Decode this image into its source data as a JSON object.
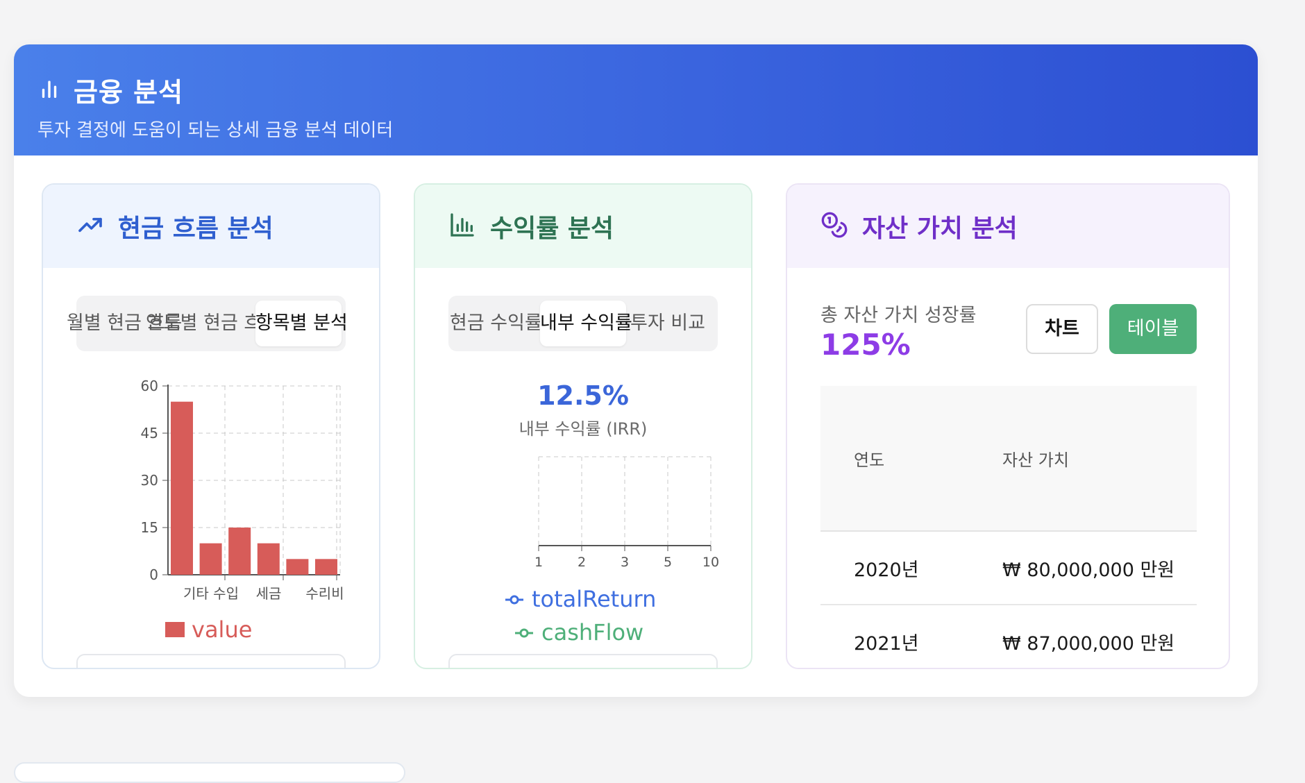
{
  "header": {
    "title": "금융 분석",
    "subtitle": "투자 결정에 도움이 되는 상세 금융 분석 데이터"
  },
  "cashflow": {
    "title": "현금 흐름 분석",
    "tabs": [
      "월별 현금 흐름",
      "연도별 현금 흐름",
      "항목별 분석"
    ],
    "active_tab": "항목별 분석",
    "chart_data": {
      "type": "bar",
      "categories": [
        "",
        "",
        "기타 수입",
        "",
        "세금",
        "",
        "수리비"
      ],
      "series": [
        {
          "name": "value",
          "values": [
            55,
            10,
            15,
            10,
            5,
            5
          ]
        }
      ],
      "ylim": [
        0,
        60
      ],
      "yticks": [
        "0",
        "15",
        "30",
        "45",
        "60"
      ],
      "xtick_labels": [
        "기타 수입",
        "세금",
        "수리비"
      ],
      "grid": true,
      "bar_color": "#d75c59",
      "legend": "bottom"
    }
  },
  "returns": {
    "title": "수익률 분석",
    "tabs": [
      "현금 수익률",
      "내부 수익률",
      "투자 비교"
    ],
    "active_tab": "내부 수익률",
    "irr_value": "12.5%",
    "irr_label": "내부 수익률 (IRR)",
    "chart_data": {
      "type": "line",
      "x": [
        "1",
        "2",
        "3",
        "5",
        "10"
      ],
      "series": [
        {
          "name": "totalReturn",
          "values": [],
          "color": "#3f6fe0"
        },
        {
          "name": "cashFlow",
          "values": [],
          "color": "#4eaf79"
        }
      ],
      "grid": true,
      "legend": "bottom"
    }
  },
  "assets": {
    "title": "자산 가치 분석",
    "growth_label": "총 자산 가치 성장률",
    "growth_value": "125%",
    "chart_button": "차트",
    "table_button": "테이블",
    "table": {
      "headers": [
        "연도",
        "자산 가치"
      ],
      "rows": [
        [
          "2020년",
          "₩ 80,000,000 만원"
        ],
        [
          "2021년",
          "₩ 87,000,000 만원"
        ]
      ]
    }
  },
  "icons": {
    "header": "bar-chart-icon",
    "cashflow": "trending-up-icon",
    "returns": "bar-chart-icon",
    "assets": "coins-icon"
  },
  "colors": {
    "header_gradient_start": "#4a80ea",
    "header_gradient_end": "#2c4fd2",
    "accent_blue": "#3f6fe0",
    "accent_green": "#4eaf79",
    "accent_purple": "#8d3ce6",
    "bar_red": "#d75c59"
  }
}
